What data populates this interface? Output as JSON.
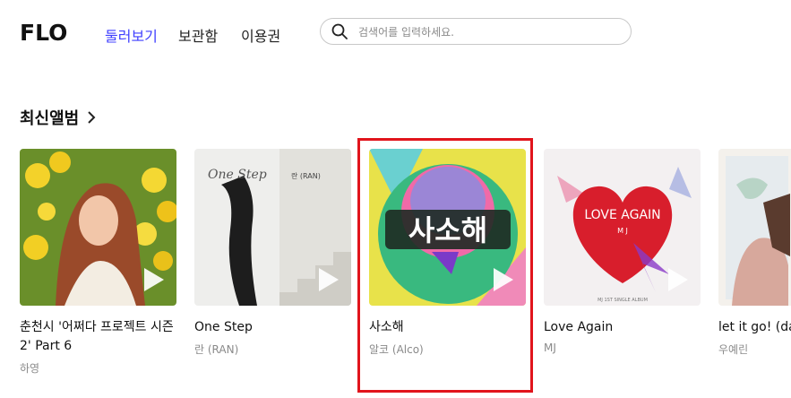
{
  "brand": {
    "logo_text": "FLO"
  },
  "nav": {
    "items": [
      "둘러보기",
      "보관함",
      "이용권"
    ]
  },
  "search": {
    "placeholder": "검색어를 입력하세요."
  },
  "section": {
    "title": "최신앨범"
  },
  "albums": [
    {
      "title": "춘천시 '어쩌다 프로젝트 시즌 2' Part 6",
      "artist": "하영"
    },
    {
      "title": "One Step",
      "artist": "란 (RAN)",
      "cover_text": "One Step",
      "cover_artist": "란 (RAN)"
    },
    {
      "title": "사소해",
      "artist": "알코 (Alco)",
      "cover_text": "사소해"
    },
    {
      "title": "Love Again",
      "artist": "MJ",
      "cover_text": "LOVE AGAIN",
      "cover_sub": "M J",
      "cover_small": "MJ 1ST SINGLE ALBUM"
    },
    {
      "title": "let it go! (da",
      "artist": "우예린"
    }
  ],
  "colors": {
    "accent": "#3f3fff",
    "highlight": "#e1141c"
  }
}
